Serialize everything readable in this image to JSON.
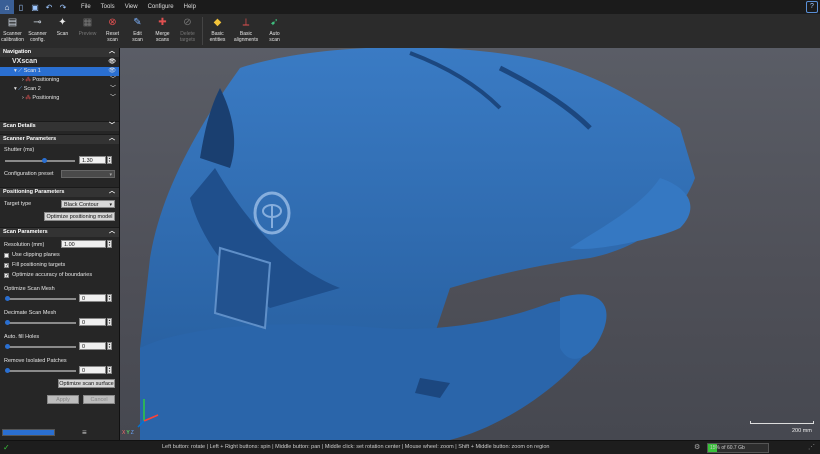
{
  "menu": [
    "File",
    "Tools",
    "View",
    "Configure",
    "Help"
  ],
  "ribbon": [
    {
      "label": "Scanner\ncalibration",
      "icon": "scanner-calibration-icon",
      "enabled": true
    },
    {
      "label": "Scanner\nconfig.",
      "icon": "scanner-config-icon",
      "enabled": true
    },
    {
      "label": "Scan",
      "icon": "scan-icon",
      "enabled": true
    },
    {
      "label": "Preview",
      "icon": "preview-icon",
      "enabled": false
    },
    {
      "label": "Reset\nscan",
      "icon": "reset-scan-icon",
      "enabled": true
    },
    {
      "label": "Edit\nscan",
      "icon": "edit-scan-icon",
      "enabled": true
    },
    {
      "label": "Merge\nscans",
      "icon": "merge-scans-icon",
      "enabled": true
    },
    {
      "label": "Delete\ntargets",
      "icon": "delete-targets-icon",
      "enabled": false
    },
    {
      "label": "Basic\nentities",
      "icon": "basic-entities-icon",
      "enabled": true
    },
    {
      "label": "Basic\nalignments",
      "icon": "basic-alignments-icon",
      "enabled": true
    },
    {
      "label": "Auto\nscan",
      "icon": "auto-scan-icon",
      "enabled": true
    }
  ],
  "navigation": {
    "title": "Navigation",
    "root": "VXscan",
    "items": [
      {
        "label": "Scan 1",
        "selected": true
      },
      {
        "label": "Positioning",
        "selected": false
      },
      {
        "label": "Scan 2",
        "selected": false
      },
      {
        "label": "Positioning",
        "selected": false
      }
    ]
  },
  "scan_details": {
    "title": "Scan Details"
  },
  "scanner_params": {
    "title": "Scanner Parameters",
    "shutter_label": "Shutter (ms)",
    "shutter_value": "1.30",
    "shutter_level": 0.55,
    "config_preset_label": "Configuration preset",
    "config_preset_value": ""
  },
  "positioning_params": {
    "title": "Positioning Parameters",
    "target_type_label": "Target type",
    "target_type_value": "Black Contour",
    "optimize_button": "Optimize positioning model"
  },
  "scan_params": {
    "title": "Scan Parameters",
    "resolution_label": "Resolution (mm)",
    "resolution_value": "1.00",
    "checks": [
      {
        "label": "Use clipping planes",
        "checked": false
      },
      {
        "label": "Fill positioning targets",
        "checked": true
      },
      {
        "label": "Optimize accuracy of boundaries",
        "checked": true
      }
    ],
    "sliders": [
      {
        "label": "Optimize Scan Mesh",
        "value": "0"
      },
      {
        "label": "Decimate Scan Mesh",
        "value": "0"
      },
      {
        "label": "Auto. fill Holes",
        "value": "0"
      },
      {
        "label": "Remove Isolated Patches",
        "value": "0"
      }
    ],
    "optimize_button": "Optimize scan surface",
    "apply_button": "Apply",
    "cancel_button": "Cancel"
  },
  "viewport": {
    "scale_label": "200 mm",
    "axes": [
      "X",
      "Y",
      "Z"
    ]
  },
  "status": {
    "message": "Left button: rotate  |  Left + Right buttons: spin  |  Middle button: pan  |  Middle click: set rotation center  |  Mouse wheel: zoom  |  Shift + Middle button: zoom on region",
    "memory_text": "15% of 60.7 Gb",
    "memory_fraction": 0.15
  },
  "colors": {
    "accent": "#2a6fd1",
    "scan": "#2d6db5",
    "memory": "#39c13a"
  }
}
